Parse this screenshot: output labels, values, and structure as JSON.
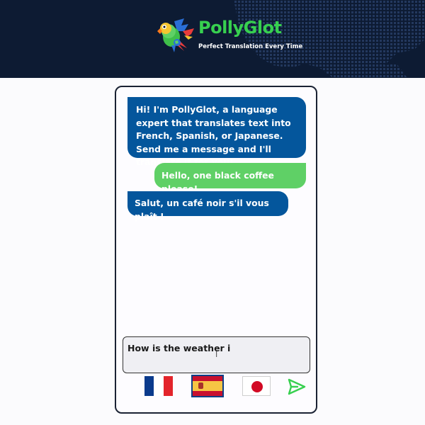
{
  "header": {
    "brand": "PollyGlot",
    "tagline": "Perfect Translation Every Time"
  },
  "messages": [
    {
      "role": "bot",
      "text": "Hi! I'm PollyGlot, a language expert that translates text into French, Spanish, or Japanese. Send me a message and I'll translate it for you!"
    },
    {
      "role": "user",
      "text": "Hello, one black coffee please!"
    },
    {
      "role": "bot",
      "text": "Salut, un café noir s'il vous plaît !"
    }
  ],
  "input": {
    "value": "How is the weather i"
  },
  "languages": [
    {
      "name": "French",
      "icon": "france-flag-icon",
      "selected": false
    },
    {
      "name": "Spanish",
      "icon": "spain-flag-icon",
      "selected": true
    },
    {
      "name": "Japanese",
      "icon": "japan-flag-icon",
      "selected": false
    }
  ],
  "colors": {
    "header_bg": "#0d1b33",
    "brand_green": "#37d04f",
    "bot_bubble": "#04569c",
    "user_bubble": "#5fd066"
  }
}
